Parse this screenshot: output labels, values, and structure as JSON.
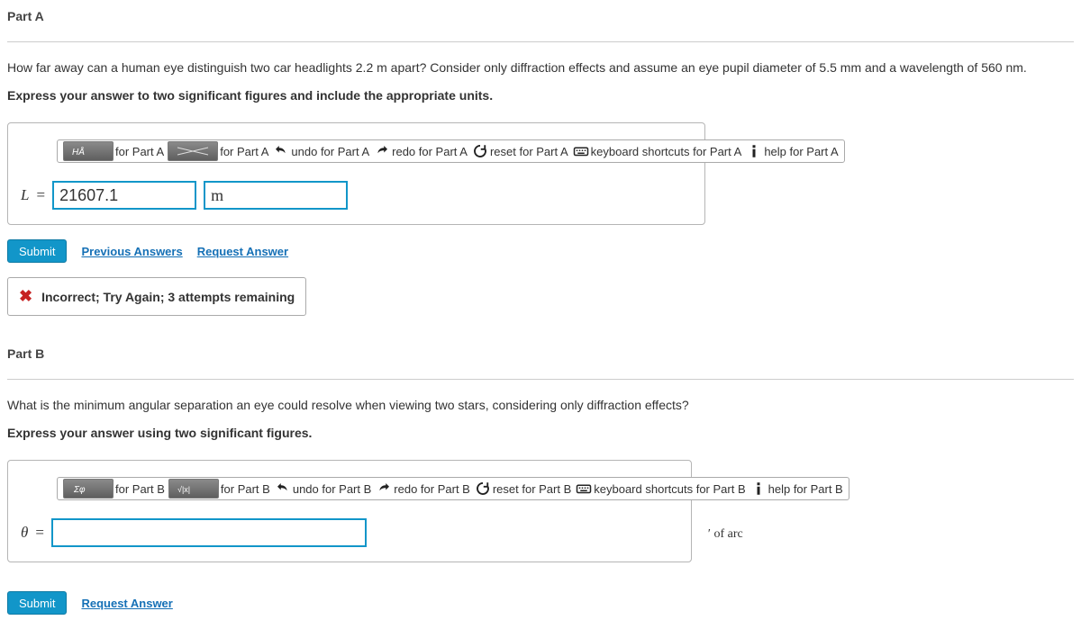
{
  "partA": {
    "label": "Part A",
    "question": "How far away can a human eye distinguish two car headlights 2.2  m apart? Consider only diffraction effects and assume an eye pupil diameter of 5.5  mm and a wavelength of 560 nm.",
    "instruction": "Express your answer to two significant figures and include the appropriate units.",
    "toolbar": {
      "t1": "for Part A",
      "t2": "for Part A",
      "undo": "undo for Part A",
      "redo": "redo for Part A",
      "reset": "reset for Part A",
      "keyboard": "keyboard shortcuts for Part A",
      "help": "help for Part A"
    },
    "var": "L",
    "eq": "=",
    "value": "21607.1",
    "unit": "m",
    "submit": "Submit",
    "prev_answers": "Previous Answers",
    "request_answer": "Request Answer",
    "feedback": "Incorrect; Try Again; 3 attempts remaining"
  },
  "partB": {
    "label": "Part B",
    "question": "What is the minimum angular separation an eye could resolve when viewing two stars, considering only diffraction effects?",
    "instruction": "Express your answer using two significant figures.",
    "toolbar": {
      "t1": "for Part B",
      "t2": "for Part B",
      "undo": "undo for Part B",
      "redo": "redo for Part B",
      "reset": "reset for Part B",
      "keyboard": "keyboard shortcuts for Part B",
      "help": "help for Part B"
    },
    "var": "θ",
    "eq": "=",
    "value": "",
    "unit_suffix": "′ of arc",
    "submit": "Submit",
    "request_answer": "Request Answer"
  }
}
